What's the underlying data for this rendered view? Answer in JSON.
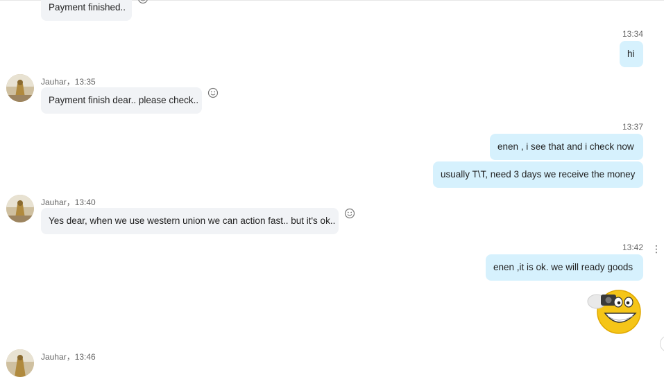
{
  "messages": [
    {
      "dir": "in",
      "text": "Payment finished.."
    },
    {
      "dir": "out",
      "time": "13:34",
      "text": "hi"
    },
    {
      "dir": "in",
      "sender": "Jauhar，13:35",
      "text": "Payment finish dear.. please check.."
    },
    {
      "dir": "out",
      "time": "13:37",
      "text": "enen , i see that and  i check now"
    },
    {
      "dir": "out",
      "text": "usually  T\\T, need 3 days we receive the money"
    },
    {
      "dir": "in",
      "sender": "Jauhar，13:40",
      "text": "Yes dear, when we use western union we can action fast.. but it's ok.."
    },
    {
      "dir": "out",
      "time": "13:42",
      "text": "enen ,it is ok. we will ready goods"
    },
    {
      "dir": "out",
      "sticker": "laughing-emoji-with-camera"
    },
    {
      "dir": "in",
      "sender": "Jauhar，13:46"
    }
  ],
  "icons": {
    "reaction": "smiley-icon",
    "more": "more-vertical-icon",
    "scroll": "scroll-down-button"
  },
  "colors": {
    "incoming_bubble": "#f1f3f6",
    "outgoing_bubble": "#d6f1fd",
    "meta_text": "#666666"
  }
}
